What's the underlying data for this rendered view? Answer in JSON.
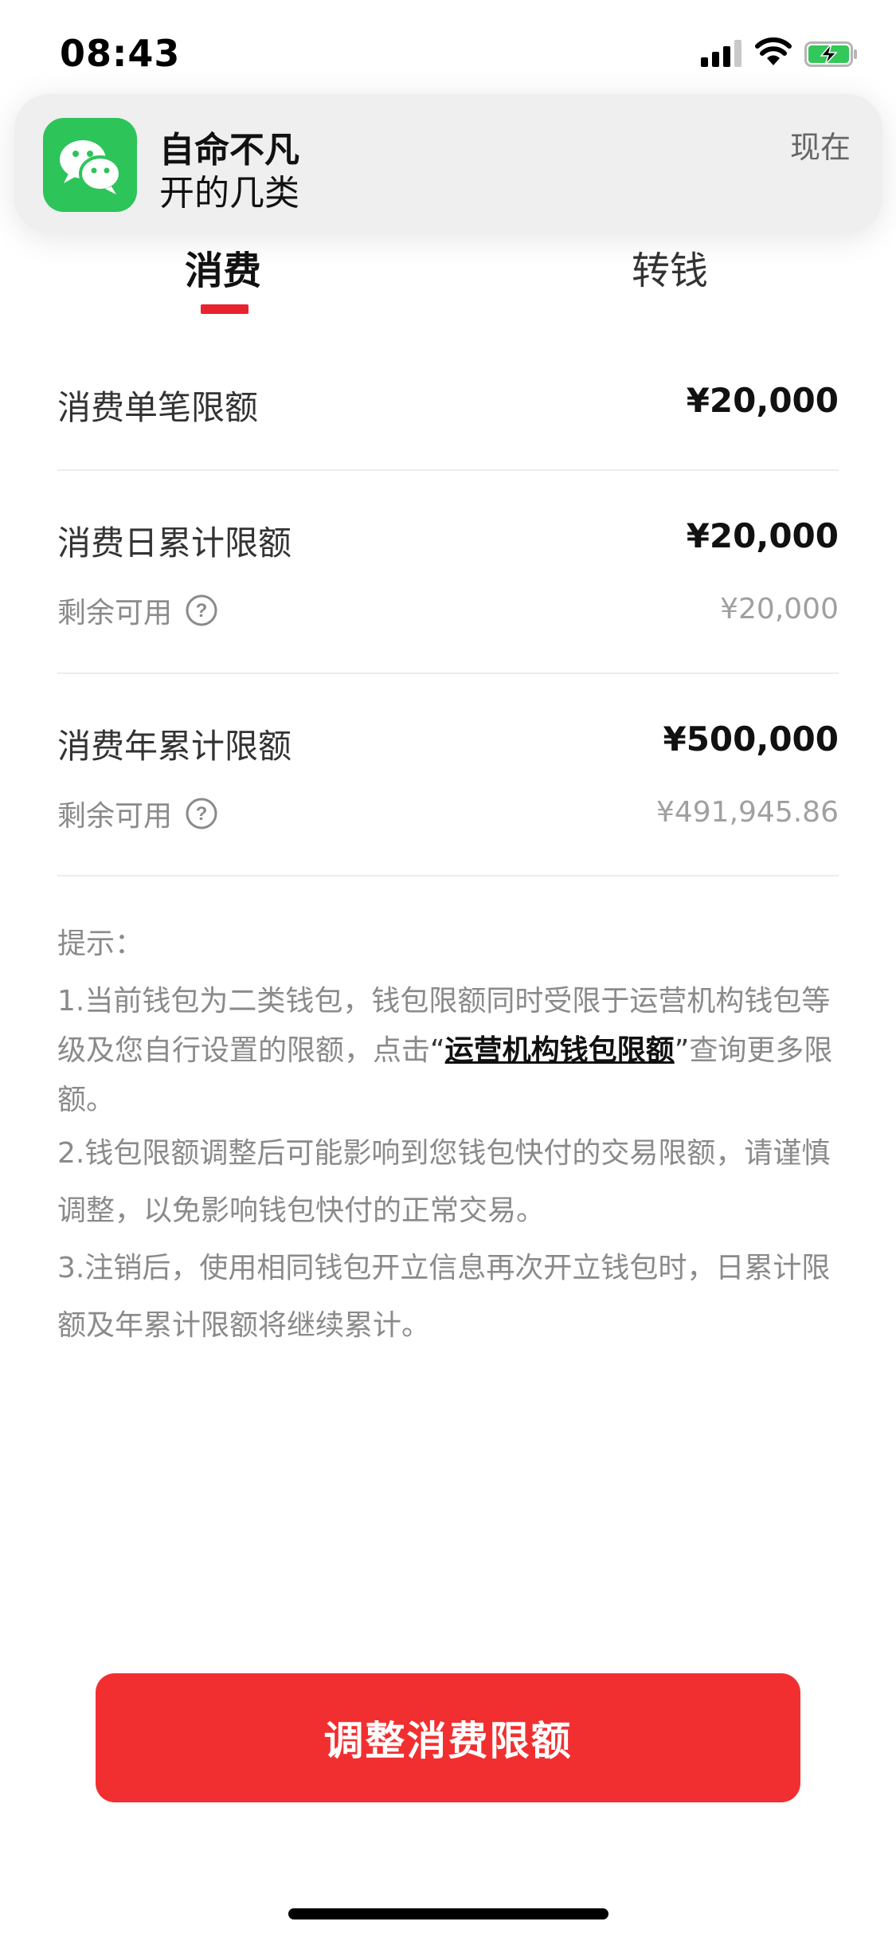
{
  "status_bar": {
    "time": "08:43",
    "icons": [
      "cellular-signal-icon",
      "wifi-icon",
      "battery-charging-icon"
    ]
  },
  "notification": {
    "app_icon": "wechat-icon",
    "title": "自命不凡",
    "body": "开的几类",
    "time": "现在"
  },
  "tabs": [
    {
      "label": "消费",
      "active": true
    },
    {
      "label": "转钱",
      "active": false
    }
  ],
  "limits": {
    "single": {
      "label": "消费单笔限额",
      "value": "¥20,000"
    },
    "daily": {
      "label": "消费日累计限额",
      "value": "¥20,000",
      "remaining_label": "剩余可用",
      "remaining_value": "¥20,000"
    },
    "yearly": {
      "label": "消费年累计限额",
      "value": "¥500,000",
      "remaining_label": "剩余可用",
      "remaining_value": "¥491,945.86"
    }
  },
  "tips": {
    "title": "提示：",
    "tip1_before": "1.当前钱包为二类钱包，钱包限额同时受限于运营机构钱包等级及您自行设置的限额，点击",
    "tip1_quote_open": "“",
    "tip1_link": "运营机构钱包限额",
    "tip1_quote_close": "”",
    "tip1_after": "查询更多限额。",
    "tip2": "2.钱包限额调整后可能影响到您钱包快付的交易限额，请谨慎调整，以免影响钱包快付的正常交易。",
    "tip3": "3.注销后，使用相同钱包开立信息再次开立钱包时，日累计限额及年累计限额将继续累计。"
  },
  "button": {
    "label": "调整消费限额"
  },
  "colors": {
    "accent": "#f22f30",
    "tab_indicator": "#e8232f",
    "wechat_green": "#2dc45a"
  }
}
